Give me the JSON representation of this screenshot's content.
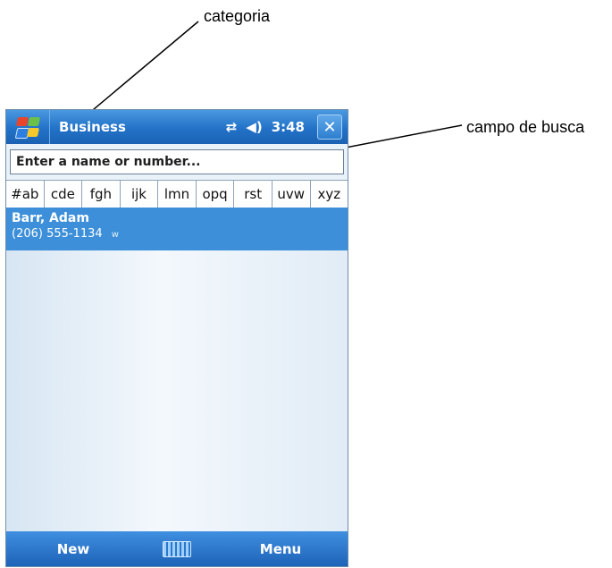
{
  "annotations": {
    "categoria": "categoria",
    "campo_de_busca": "campo de busca"
  },
  "titlebar": {
    "start_icon": "windows-flag-icon",
    "title": "Business",
    "connectivity_icon": "connectivity-icon",
    "connectivity_glyph": "⇄",
    "volume_icon": "speaker-icon",
    "volume_glyph": "◀)",
    "time": "3:48",
    "close_glyph": "✕"
  },
  "search": {
    "placeholder": "Enter a name or number...",
    "value": ""
  },
  "letter_tabs": [
    "#ab",
    "cde",
    "fgh",
    "ijk",
    "lmn",
    "opq",
    "rst",
    "uvw",
    "xyz"
  ],
  "contacts": [
    {
      "name": "Barr, Adam",
      "phone": "(206) 555-1134",
      "type": "w"
    }
  ],
  "bottombar": {
    "left_softkey": "New",
    "input_icon": "keyboard-icon",
    "right_softkey": "Menu"
  },
  "colors": {
    "titlebar": "#2272c8",
    "selection": "#3c8fd8",
    "list_background": "#eaf2f9"
  }
}
